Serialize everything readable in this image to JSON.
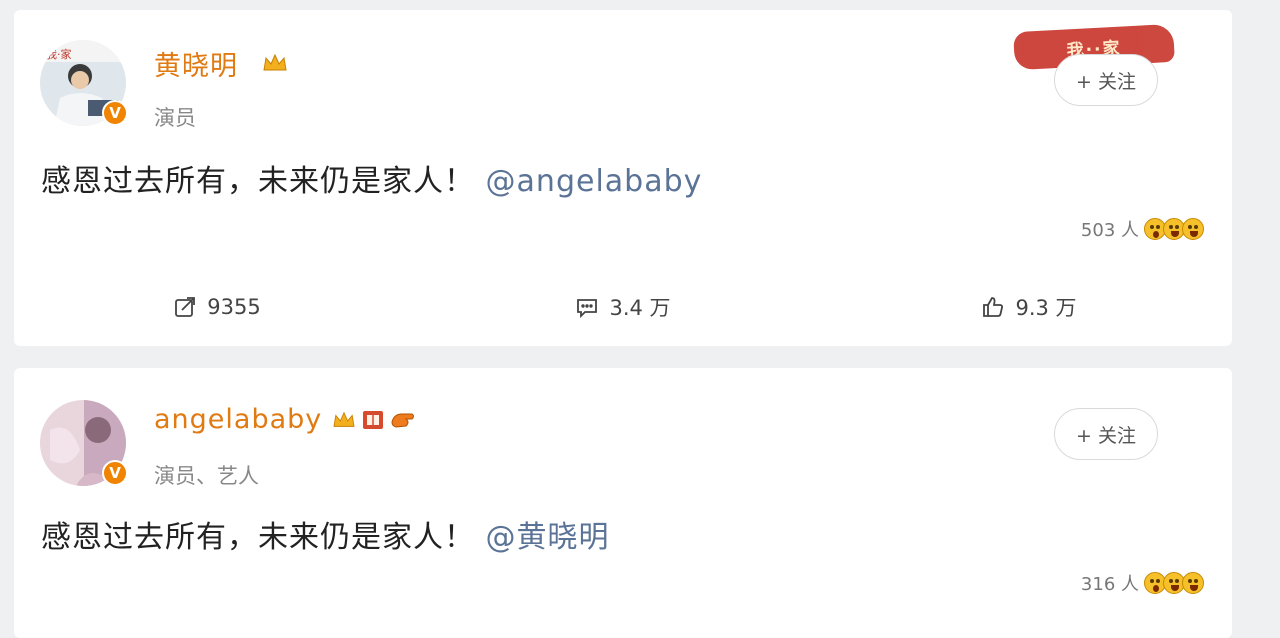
{
  "posts": [
    {
      "username": "黄晓明",
      "subtitle": "演员",
      "verified_badge": "V",
      "follow_label": "+ 关注",
      "text_main": "感恩过去所有，未来仍是家人！",
      "text_mention": "@angelababy",
      "reaction_count": "503 人",
      "stats": {
        "repost": "9355",
        "comment": "3.4 万",
        "like": "9.3 万"
      },
      "colors": {
        "username": "#e07a12",
        "mention": "#5a7396"
      }
    },
    {
      "username": "angelababy",
      "subtitle": "演员、艺人",
      "verified_badge": "V",
      "follow_label": "+ 关注",
      "text_main": "感恩过去所有，未来仍是家人！",
      "text_mention": "@黄晓明",
      "reaction_count": "316 人"
    }
  ],
  "icons": {
    "crown": "crown-icon",
    "repost": "repost-icon",
    "comment": "comment-icon",
    "like": "thumbs-up-icon"
  }
}
